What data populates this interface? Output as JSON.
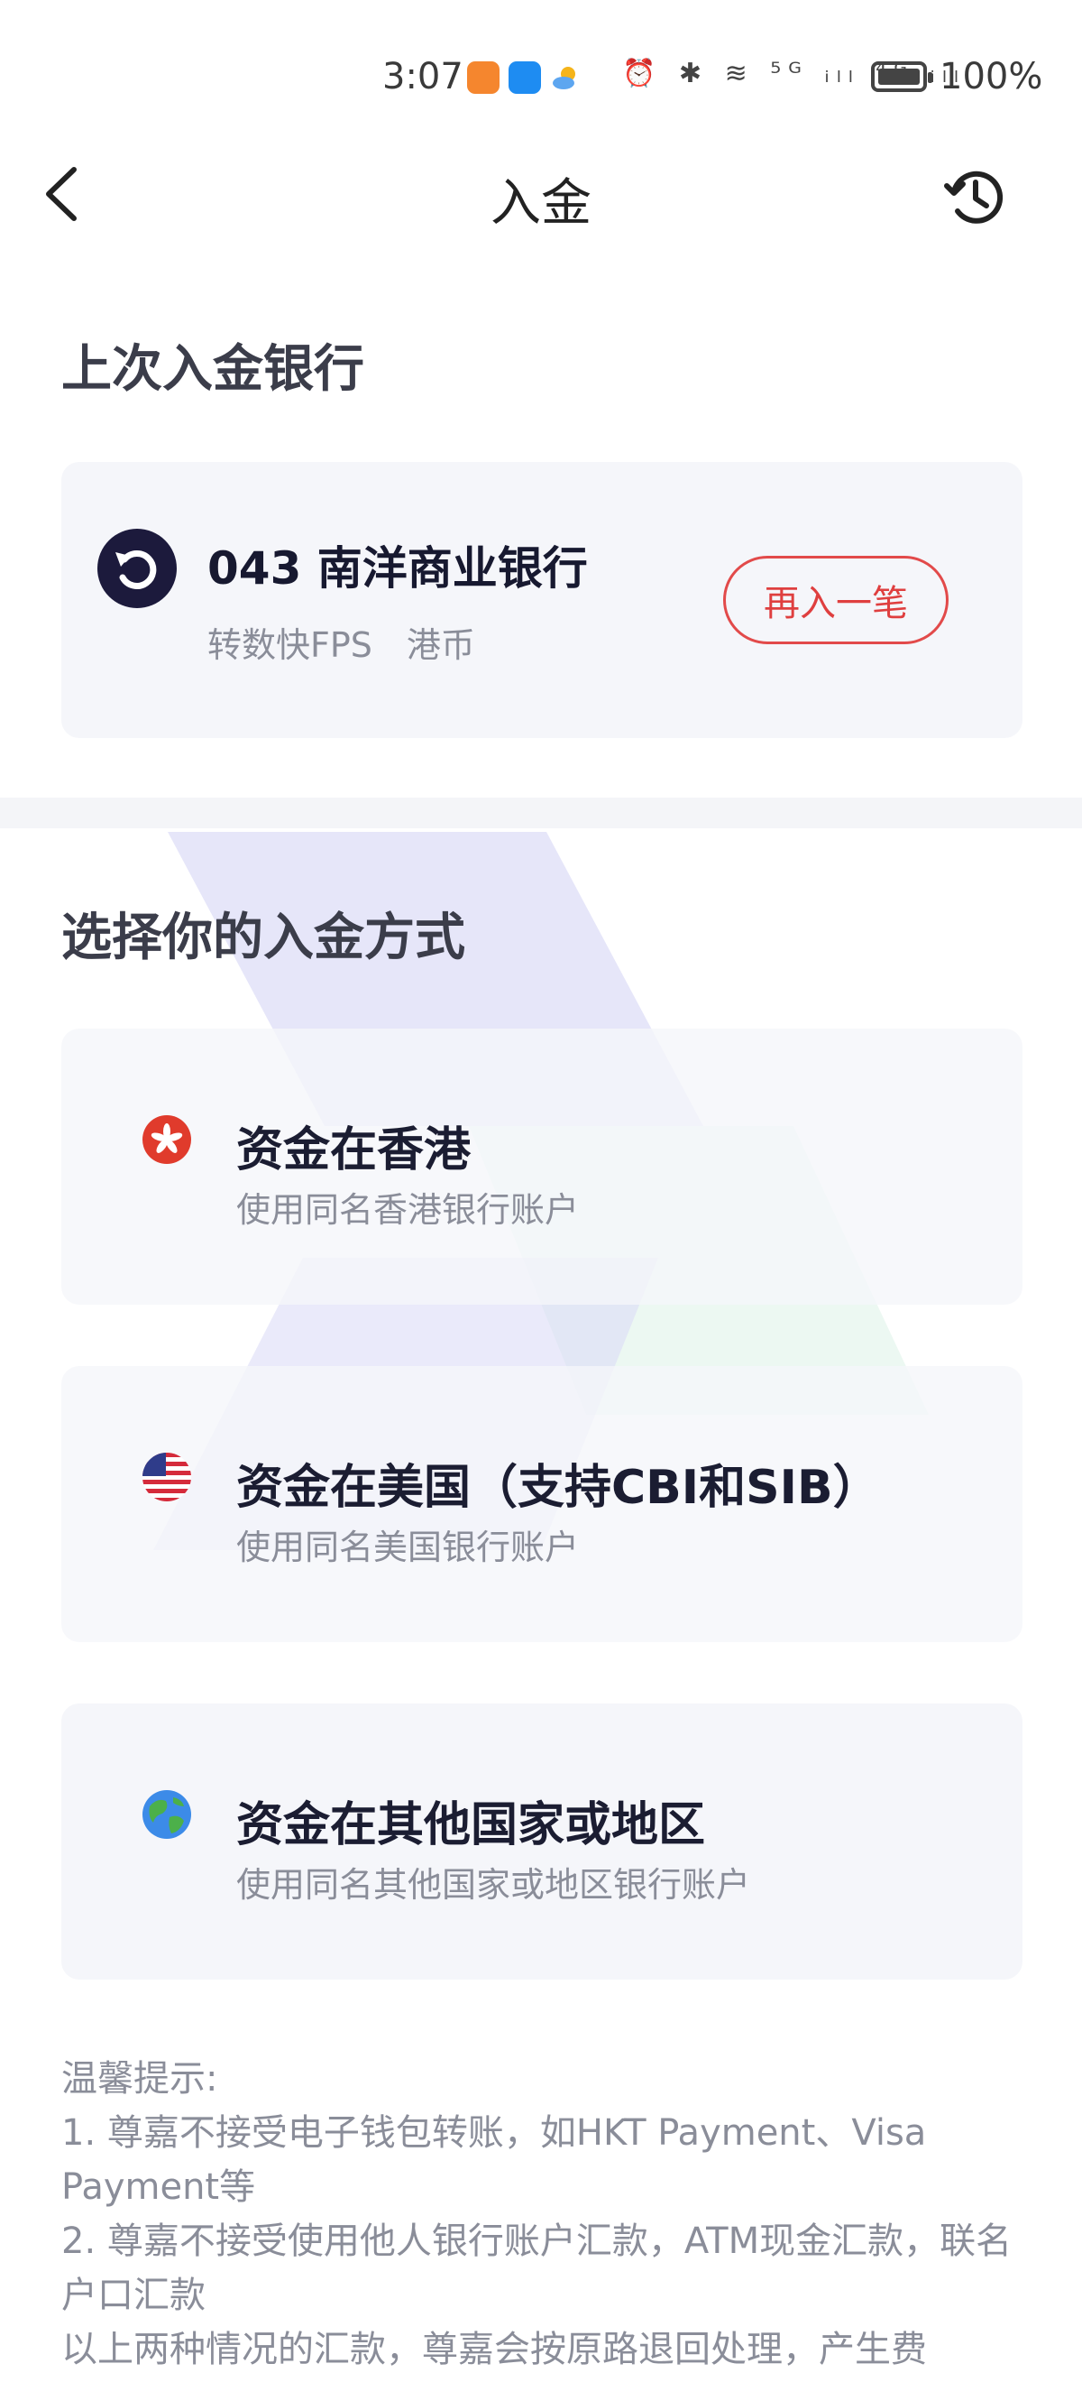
{
  "status_bar": {
    "time": "3:07",
    "indicators": "⏰ ✱ ≋ ⁵ᴳ ᵢₗₗ ⁴ᴳ ᵢₗₗ",
    "battery": "100%"
  },
  "nav": {
    "back_icon": "chevron-left-icon",
    "title": "入金",
    "history_icon": "history-icon"
  },
  "last_bank": {
    "section_title": "上次入金银行",
    "bank_name": "043 南洋商业银行",
    "bank_sub": "转数快FPS　港币",
    "again_button": "再入一笔"
  },
  "methods": {
    "section_title": "选择你的入金方式",
    "items": [
      {
        "icon": "hong-kong-flag-icon",
        "title": "资金在香港",
        "subtitle": "使用同名香港银行账户"
      },
      {
        "icon": "us-flag-icon",
        "title": "资金在美国（支持CBI和SIB）",
        "subtitle": "使用同名美国银行账户"
      },
      {
        "icon": "globe-icon",
        "title": "资金在其他国家或地区",
        "subtitle": "使用同名其他国家或地区银行账户"
      }
    ]
  },
  "tips": {
    "heading": "温馨提示:",
    "line1": "1. 尊嘉不接受电子钱包转账，如HKT Payment、Visa Payment等",
    "line2": "2. 尊嘉不接受使用他人银行账户汇款，ATM现金汇款，联名户口汇款",
    "line3": "以上两种情况的汇款，尊嘉会按原路退回处理，产生费"
  },
  "colors": {
    "accent_red": "#e24a4a",
    "card_bg": "#f5f6fa",
    "bank_logo_bg": "#1c1a3c"
  }
}
